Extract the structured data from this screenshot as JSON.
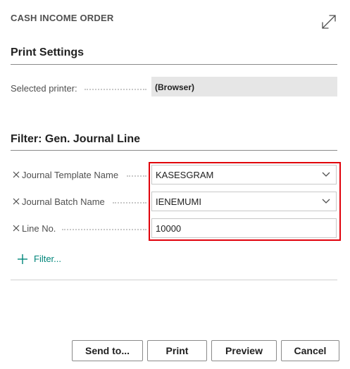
{
  "dialog": {
    "title": "CASH INCOME ORDER",
    "expand_icon": "expand-diagonal-arrows-icon"
  },
  "print_settings": {
    "title": "Print Settings",
    "printer_label": "Selected printer:",
    "printer_value": "(Browser)"
  },
  "filter": {
    "title": "Filter: Gen. Journal Line",
    "remove_icon": "x-icon",
    "fields": [
      {
        "label": "Journal Template Name",
        "value": "KASESGRAM",
        "has_dropdown": true
      },
      {
        "label": "Journal Batch Name",
        "value": "IENEMUMI",
        "has_dropdown": true
      },
      {
        "label": "Line No.",
        "value": "10000",
        "has_dropdown": false
      }
    ],
    "add_filter_label": "Filter...",
    "add_filter_icon": "plus-icon"
  },
  "buttons": {
    "send_to": "Send to...",
    "print": "Print",
    "preview": "Preview",
    "cancel": "Cancel"
  },
  "colors": {
    "highlight": "#e0000a",
    "link": "#00857a",
    "readonly_bg": "#e6e6e6"
  }
}
